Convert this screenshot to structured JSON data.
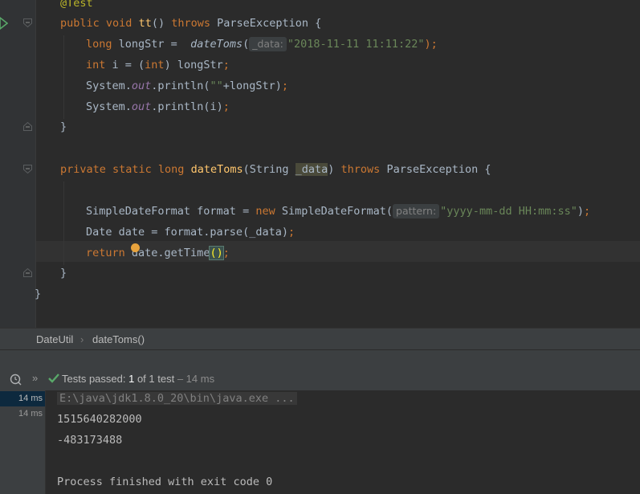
{
  "editor": {
    "l1": {
      "ann": "@Test"
    },
    "l2": {
      "mod": "public",
      "type": "void",
      "name": "tt",
      "parens": "()",
      "throws": "throws",
      "exc": "ParseException {"
    },
    "l3": {
      "type": "long",
      "var": " longStr = ",
      "call": "dateToms",
      "open": "(",
      "hint": "_data:",
      "str": "\"2018-11-11 11:11:22\"",
      "close": ");"
    },
    "l4": {
      "type": "int",
      "mid": " i = (",
      "cast": "int",
      "rest": ") longStr",
      "semi": ";"
    },
    "l5": {
      "pre": "System.",
      "field": "out",
      "post": ".println(",
      "str": "\"\"",
      "rest": "+longStr)",
      "semi": ";"
    },
    "l6": {
      "pre": "System.",
      "field": "out",
      "post": ".println(i)",
      "semi": ";"
    },
    "l7": {
      "text": "}"
    },
    "l8": {
      "mod": "private static long",
      "name": "dateToms",
      "open": "(String ",
      "param": "_data",
      "close": ") ",
      "throws": "throws",
      "exc": " ParseException {"
    },
    "l9": {
      "pre": "SimpleDateFormat format = ",
      "kw": "new",
      "cls": " SimpleDateFormat(",
      "hint": "pattern:",
      "str": "\"yyyy-mm-dd HH:mm:ss\"",
      "close": ")",
      "semi": ";"
    },
    "l10": {
      "text": "Date date = format.parse(_data)",
      "semi": ";"
    },
    "l11": {
      "kw": "return",
      "pre": " date.getTime",
      "paren": "()",
      "semi": ";"
    },
    "l12": {
      "text": "}"
    },
    "l13": {
      "text": "}"
    }
  },
  "breadcrumb": {
    "class": "DateUtil",
    "sep": "›",
    "method": "dateToms()"
  },
  "runbar": {
    "passed": "Tests passed: ",
    "count": "1",
    "of": " of 1 test",
    "dur": " – 14 ms"
  },
  "tree": {
    "r1": "14 ms",
    "r2": "14 ms"
  },
  "console": {
    "cmd": "E:\\java\\jdk1.8.0_20\\bin\\java.exe ...",
    "out1": "1515640282000",
    "out2": "-483173488",
    "out3": "Process finished with exit code 0"
  },
  "colors": {
    "keyword": "#cc7832",
    "string": "#6a8759",
    "method": "#ffc66d",
    "field": "#9876aa",
    "pass": "#59a869"
  }
}
